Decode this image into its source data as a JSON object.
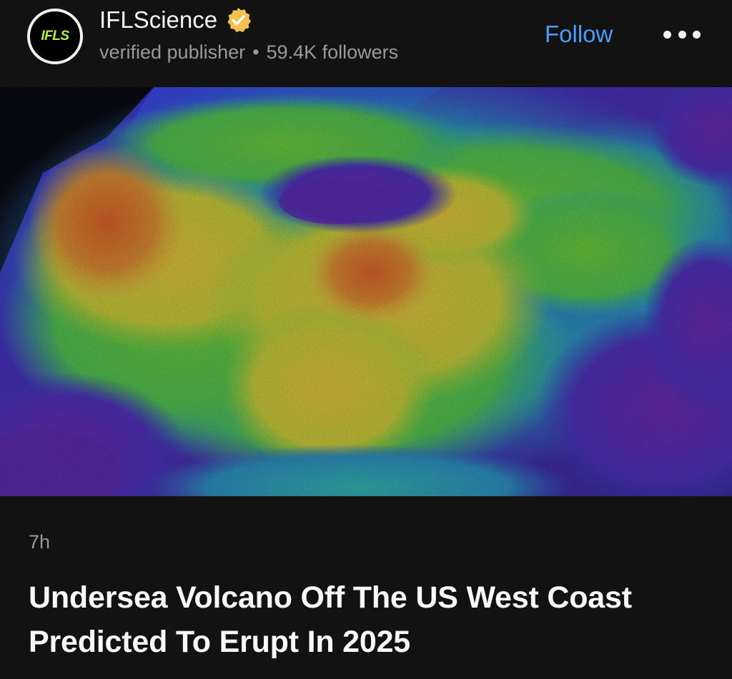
{
  "publisher": {
    "name": "IFLScience",
    "avatar_text": "IFLS",
    "verified_icon": "verified-badge-icon",
    "type_label": "verified publisher",
    "separator": "•",
    "followers": "59.4K followers"
  },
  "actions": {
    "follow_label": "Follow",
    "more_icon": "more-options-icon"
  },
  "article": {
    "image_description_icon": "bathymetry-image",
    "time_ago": "7h",
    "headline": "Undersea Volcano Off The US West Coast Predicted To Erupt In 2025"
  },
  "colors": {
    "background": "#121212",
    "accent_blue": "#4a9dfc",
    "verified_gold": "#f2c14e",
    "avatar_green": "#b6f23a",
    "meta_gray": "#9a9a9a"
  }
}
